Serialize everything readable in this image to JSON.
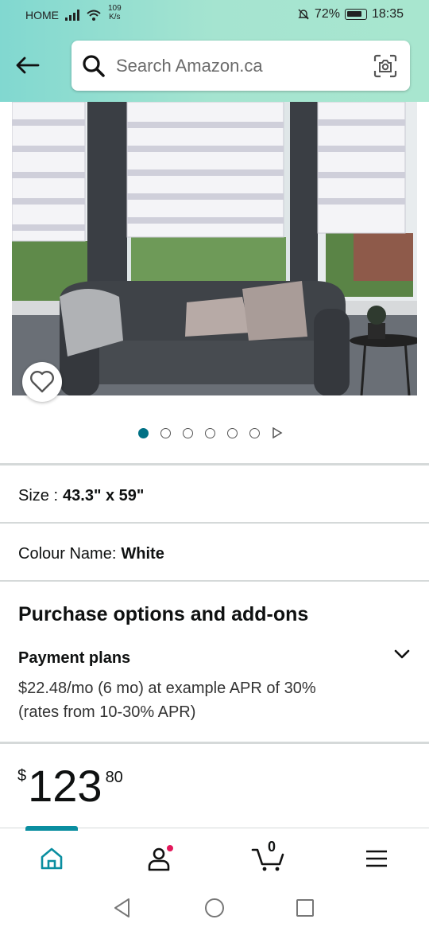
{
  "status_bar": {
    "carrier": "HOME",
    "net_speed_value": "109",
    "net_speed_unit": "K/s",
    "battery": "72%",
    "time": "18:35"
  },
  "header": {
    "search_placeholder": "Search Amazon.ca"
  },
  "product": {
    "image_icon": "window-blinds-photo",
    "carousel": {
      "total": 6,
      "active_index": 0
    },
    "size_label": "Size :",
    "size_value": "43.3\" x 59\"",
    "colour_label": "Colour Name:",
    "colour_value": "White"
  },
  "purchase": {
    "section_title": "Purchase options and add-ons",
    "payment_title": "Payment plans",
    "payment_desc": "$22.48/mo (6 mo) at example APR of 30% (rates from 10-30% APR)",
    "price_currency": "$",
    "price_whole": "123",
    "price_fraction": "80"
  },
  "bottom_nav": {
    "cart_count": "0",
    "items": [
      "home-icon",
      "account-icon",
      "cart-icon",
      "menu-icon"
    ]
  },
  "colors": {
    "accent": "#007185",
    "header_gradient_start": "#81d8d0",
    "header_gradient_end": "#a8e6cf",
    "notification_dot": "#e3185b"
  }
}
